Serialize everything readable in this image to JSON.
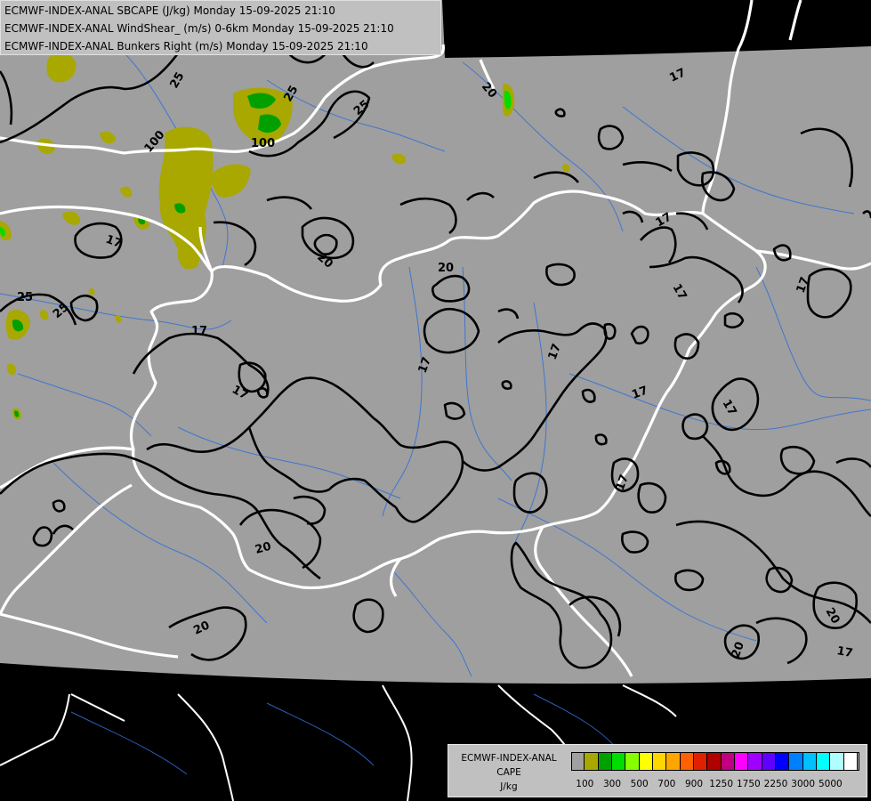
{
  "header": {
    "line1": "ECMWF-INDEX-ANAL SBCAPE (J/kg) Monday 15-09-2025 21:10",
    "line2": "ECMWF-INDEX-ANAL WindShear_ (m/s) 0-6km Monday 15-09-2025 21:10",
    "line3": "ECMWF-INDEX-ANAL Bunkers Right (m/s) Monday 15-09-2025 21:10"
  },
  "legend": {
    "title_line1": "ECMWF-INDEX-ANAL",
    "title_line2": "CAPE",
    "title_line3": "J/kg",
    "colors": [
      "#a0a0a0",
      "#a8a800",
      "#00a000",
      "#00dd00",
      "#88ff00",
      "#ffff00",
      "#ffd700",
      "#ffa500",
      "#ff6000",
      "#e02000",
      "#b00000",
      "#c00080",
      "#ff00ff",
      "#a000ff",
      "#6000ff",
      "#0000ff",
      "#0080ff",
      "#00c0ff",
      "#00ffff",
      "#b0ffff",
      "#ffffff"
    ],
    "ticks": [
      "100",
      "300",
      "500",
      "700",
      "900",
      "1250",
      "1750",
      "2250",
      "3000",
      "5000"
    ]
  },
  "contour_labels": [
    {
      "id": "c25a",
      "text": "25"
    },
    {
      "id": "c25b",
      "text": "25"
    },
    {
      "id": "c25c",
      "text": "25"
    },
    {
      "id": "c25d",
      "text": "25"
    },
    {
      "id": "c25e",
      "text": "25"
    },
    {
      "id": "c100a",
      "text": "100"
    },
    {
      "id": "c100b",
      "text": "100"
    },
    {
      "id": "c17a",
      "text": "17"
    },
    {
      "id": "c17b",
      "text": "17"
    },
    {
      "id": "c17c",
      "text": "17"
    },
    {
      "id": "c17d",
      "text": "17"
    },
    {
      "id": "c17e",
      "text": "17"
    },
    {
      "id": "c17f",
      "text": "17"
    },
    {
      "id": "c17g",
      "text": "17"
    },
    {
      "id": "c17h",
      "text": "17"
    },
    {
      "id": "c17i",
      "text": "17"
    },
    {
      "id": "c17j",
      "text": "17"
    },
    {
      "id": "c17k",
      "text": "17"
    },
    {
      "id": "c17l",
      "text": "17"
    },
    {
      "id": "c17m",
      "text": "17"
    },
    {
      "id": "c20a",
      "text": "20"
    },
    {
      "id": "c20b",
      "text": "20"
    },
    {
      "id": "c20c",
      "text": "20"
    },
    {
      "id": "c20d",
      "text": "20"
    },
    {
      "id": "c20e",
      "text": "20"
    },
    {
      "id": "c20f",
      "text": "20"
    },
    {
      "id": "c20g",
      "text": "20"
    }
  ]
}
